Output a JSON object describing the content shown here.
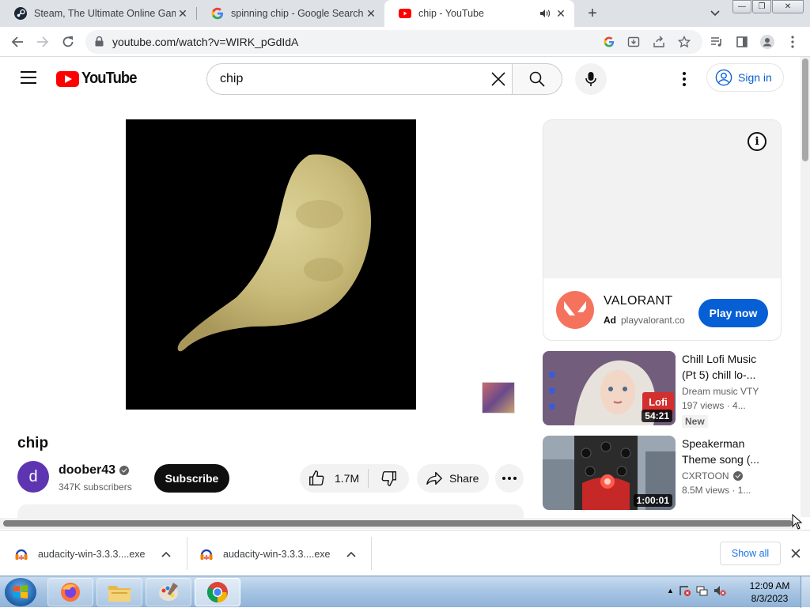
{
  "browser": {
    "tabs": [
      {
        "title": "Steam, The Ultimate Online Gam",
        "favicon": "steam-icon",
        "active": false
      },
      {
        "title": "spinning chip - Google Search",
        "favicon": "google-icon",
        "active": false
      },
      {
        "title": "chip - YouTube",
        "favicon": "youtube-icon",
        "active": true
      }
    ],
    "url": "youtube.com/watch?v=WIRK_pGdIdA"
  },
  "youtube": {
    "logo_text": "YouTube",
    "search_value": "chip",
    "sign_in": "Sign in",
    "video": {
      "title": "chip",
      "channel": "doober43",
      "avatar_letter": "d",
      "subscribers": "347K subscribers",
      "subscribe_label": "Subscribe",
      "likes": "1.7M",
      "share_label": "Share"
    },
    "ad": {
      "name": "VALORANT",
      "label": "Ad",
      "domain": "playvalorant.co",
      "cta": "Play now"
    },
    "suggestions": [
      {
        "title": "Chill Lofi Music (Pt 5) chill lo-...",
        "channel": "Dream music VTY",
        "views": "197 views · 4...",
        "duration": "54:21",
        "badge": "New",
        "verified": false
      },
      {
        "title": "Speakerman Theme song (...",
        "channel": "CXRTOON",
        "views": "8.5M views · 1...",
        "duration": "1:00:01",
        "badge": "",
        "verified": true
      }
    ]
  },
  "downloads": {
    "items": [
      "audacity-win-3.3.3....exe",
      "audacity-win-3.3.3....exe"
    ],
    "show_all": "Show all"
  },
  "taskbar": {
    "time": "12:09 AM",
    "date": "8/3/2023"
  },
  "colors": {
    "youtube_red": "#ff0000",
    "link_blue": "#065fd4",
    "chrome_tabstrip": "#dee1e6"
  }
}
